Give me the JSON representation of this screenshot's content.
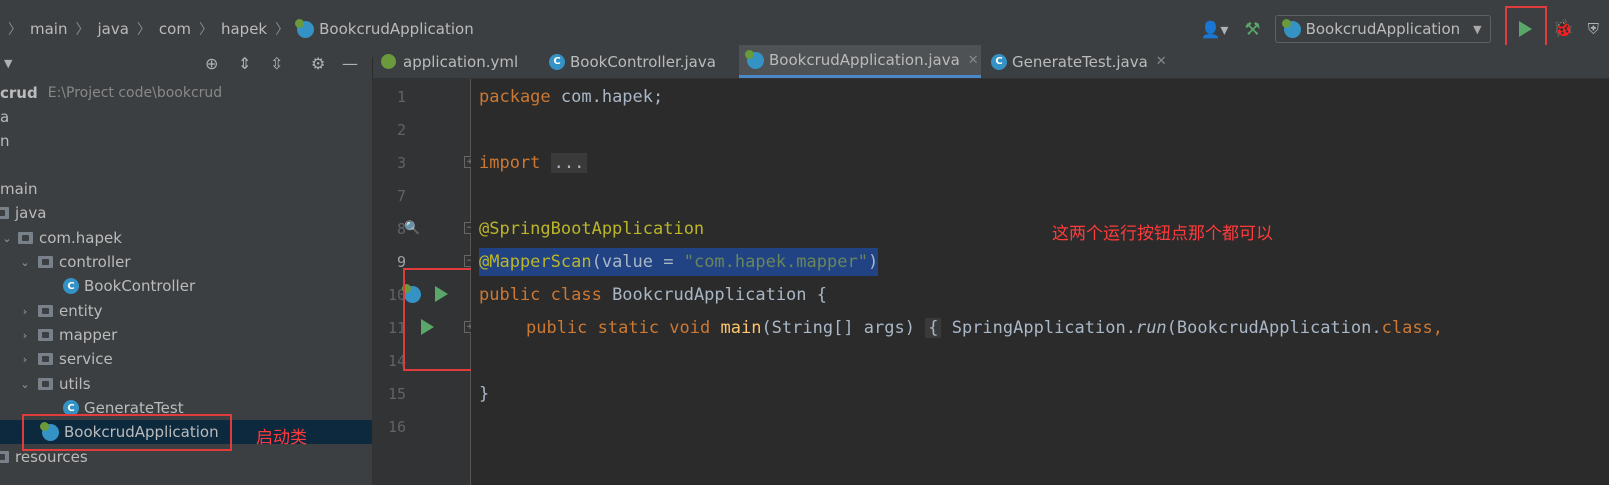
{
  "breadcrumb": [
    "main",
    "java",
    "com",
    "hapek",
    "BookcrudApplication"
  ],
  "toolbar": {
    "run_config": "BookcrudApplication"
  },
  "project": {
    "root_name": "crud",
    "root_path": "E:\\Project code\\bookcrud",
    "rows": [
      {
        "label": "a",
        "indent": 0,
        "kind": "text"
      },
      {
        "label": "n",
        "indent": 0,
        "kind": "text"
      },
      {
        "label": "",
        "indent": 0,
        "kind": "text"
      },
      {
        "label": "main",
        "indent": 0,
        "kind": "text"
      },
      {
        "label": "java",
        "indent": 0,
        "kind": "folder"
      },
      {
        "label": "com.hapek",
        "indent": 1,
        "kind": "folder",
        "chevron": "open"
      },
      {
        "label": "controller",
        "indent": 2,
        "kind": "folder",
        "chevron": "open"
      },
      {
        "label": "BookController",
        "indent": 3,
        "kind": "class"
      },
      {
        "label": "entity",
        "indent": 2,
        "kind": "folder",
        "chevron": "closed"
      },
      {
        "label": "mapper",
        "indent": 2,
        "kind": "folder",
        "chevron": "closed"
      },
      {
        "label": "service",
        "indent": 2,
        "kind": "folder",
        "chevron": "closed"
      },
      {
        "label": "utils",
        "indent": 2,
        "kind": "folder",
        "chevron": "open"
      },
      {
        "label": "GenerateTest",
        "indent": 3,
        "kind": "class"
      },
      {
        "label": "BookcrudApplication",
        "indent": 2,
        "kind": "springboot",
        "selected": true
      },
      {
        "label": "resources",
        "indent": 0,
        "kind": "folder"
      }
    ]
  },
  "tabs": [
    {
      "label": "application.yml",
      "icon": "yml-icon",
      "active": false
    },
    {
      "label": "BookController.java",
      "icon": "class-icon",
      "active": false
    },
    {
      "label": "BookcrudApplication.java",
      "icon": "springboot-icon",
      "active": true
    },
    {
      "label": "GenerateTest.java",
      "icon": "class-icon",
      "active": false
    }
  ],
  "editor": {
    "line_numbers": [
      "1",
      "2",
      "3",
      "7",
      "8",
      "9",
      "10",
      "11",
      "14",
      "15",
      "16"
    ],
    "lines": {
      "l1_kw": "package",
      "l1_rest": " com.hapek;",
      "l3_kw": "import",
      "l3_fold": "...",
      "l8_ann": "@SpringBootApplication",
      "l9_ann": "@MapperScan",
      "l9_open": "(value = ",
      "l9_str": "\"com.hapek.mapper\"",
      "l9_close": ")",
      "l10_kw": "public class",
      "l10_rest": " BookcrudApplication {",
      "l11_kw": "public static void",
      "l11_fn": "main",
      "l11_args": "(String[] args)",
      "l11_brace": "{",
      "l11_call": "SpringApplication.",
      "l11_run": "run",
      "l11_paren": "(BookcrudApplication.",
      "l11_class": "class,",
      "l15_brace": "}"
    }
  },
  "annotations": {
    "run_note": "这两个运行按钮点那个都可以",
    "startup_note": "启动类"
  },
  "colors": {
    "accent": "#4a88c7",
    "annotation_red": "#e03c3c",
    "run_green": "#59a869"
  }
}
